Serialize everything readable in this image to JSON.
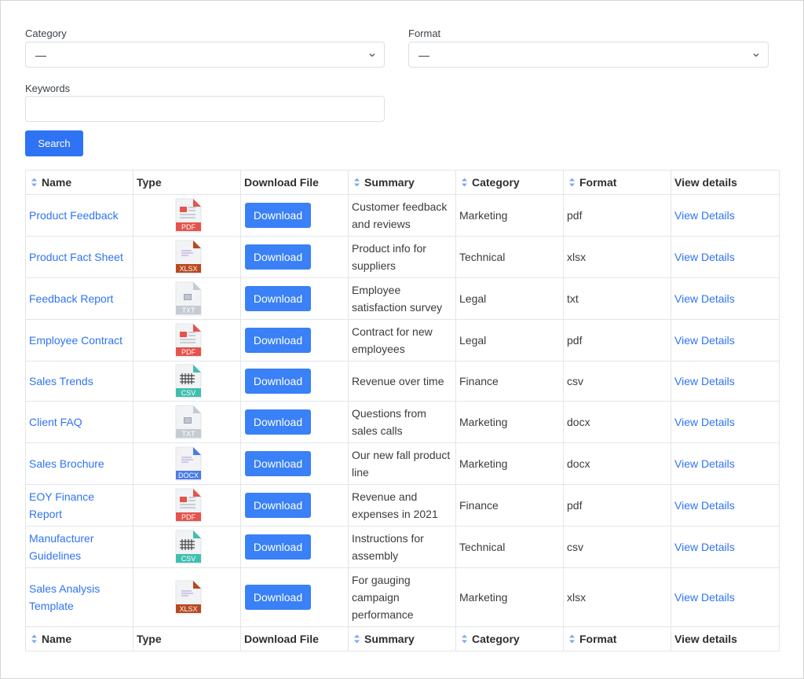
{
  "filters": {
    "category": {
      "label": "Category",
      "value": "—"
    },
    "format": {
      "label": "Format",
      "value": "—"
    },
    "keywords": {
      "label": "Keywords",
      "value": "",
      "placeholder": ""
    },
    "search_label": "Search"
  },
  "table": {
    "headers": {
      "name": "Name",
      "type": "Type",
      "download": "Download File",
      "summary": "Summary",
      "category": "Category",
      "format": "Format",
      "view": "View details"
    },
    "rows": [
      {
        "name": "Product Feedback",
        "type_icon": "PDF",
        "download": "Download",
        "summary": "Customer feedback and reviews",
        "category": "Marketing",
        "format": "pdf",
        "view": "View Details"
      },
      {
        "name": "Product Fact Sheet",
        "type_icon": "XLSX",
        "download": "Download",
        "summary": "Product info for suppliers",
        "category": "Technical",
        "format": "xlsx",
        "view": "View Details"
      },
      {
        "name": "Feedback Report",
        "type_icon": "TXT",
        "download": "Download",
        "summary": "Employee satisfaction survey",
        "category": "Legal",
        "format": "txt",
        "view": "View Details"
      },
      {
        "name": "Employee Contract",
        "type_icon": "PDF",
        "download": "Download",
        "summary": "Contract for new employees",
        "category": "Legal",
        "format": "pdf",
        "view": "View Details"
      },
      {
        "name": "Sales Trends",
        "type_icon": "CSV",
        "download": "Download",
        "summary": "Revenue over time",
        "category": "Finance",
        "format": "csv",
        "view": "View Details"
      },
      {
        "name": "Client FAQ",
        "type_icon": "TXT",
        "download": "Download",
        "summary": "Questions from sales calls",
        "category": "Marketing",
        "format": "docx",
        "view": "View Details"
      },
      {
        "name": "Sales Brochure",
        "type_icon": "DOCX",
        "download": "Download",
        "summary": "Our new fall product line",
        "category": "Marketing",
        "format": "docx",
        "view": "View Details"
      },
      {
        "name": "EOY Finance Report",
        "type_icon": "PDF",
        "download": "Download",
        "summary": "Revenue and expenses in 2021",
        "category": "Finance",
        "format": "pdf",
        "view": "View Details"
      },
      {
        "name": "Manufacturer Guidelines",
        "type_icon": "CSV",
        "download": "Download",
        "summary": "Instructions for assembly",
        "category": "Technical",
        "format": "csv",
        "view": "View Details"
      },
      {
        "name": "Sales Analysis Template",
        "type_icon": "XLSX",
        "download": "Download",
        "summary": "For gauging campaign performance",
        "category": "Marketing",
        "format": "xlsx",
        "view": "View Details"
      }
    ]
  },
  "colors": {
    "accent": "#2f73f5",
    "pdf": "#e5534b",
    "xlsx": "#b8481e",
    "txt": "#c5cbd3",
    "csv": "#3fbfb0",
    "docx": "#4a7be8"
  }
}
